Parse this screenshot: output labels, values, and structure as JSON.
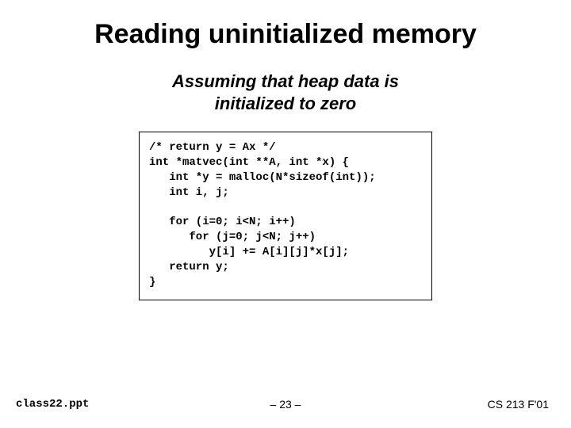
{
  "title": "Reading uninitialized memory",
  "subtitle_line1": "Assuming that heap data is",
  "subtitle_line2": "initialized to zero",
  "code": "/* return y = Ax */\nint *matvec(int **A, int *x) {\n   int *y = malloc(N*sizeof(int));\n   int i, j;\n\n   for (i=0; i<N; i++)\n      for (j=0; j<N; j++)\n         y[i] += A[i][j]*x[j];\n   return y;\n}",
  "footer": {
    "left": "class22.ppt",
    "center": "– 23 –",
    "right": "CS 213 F'01"
  }
}
